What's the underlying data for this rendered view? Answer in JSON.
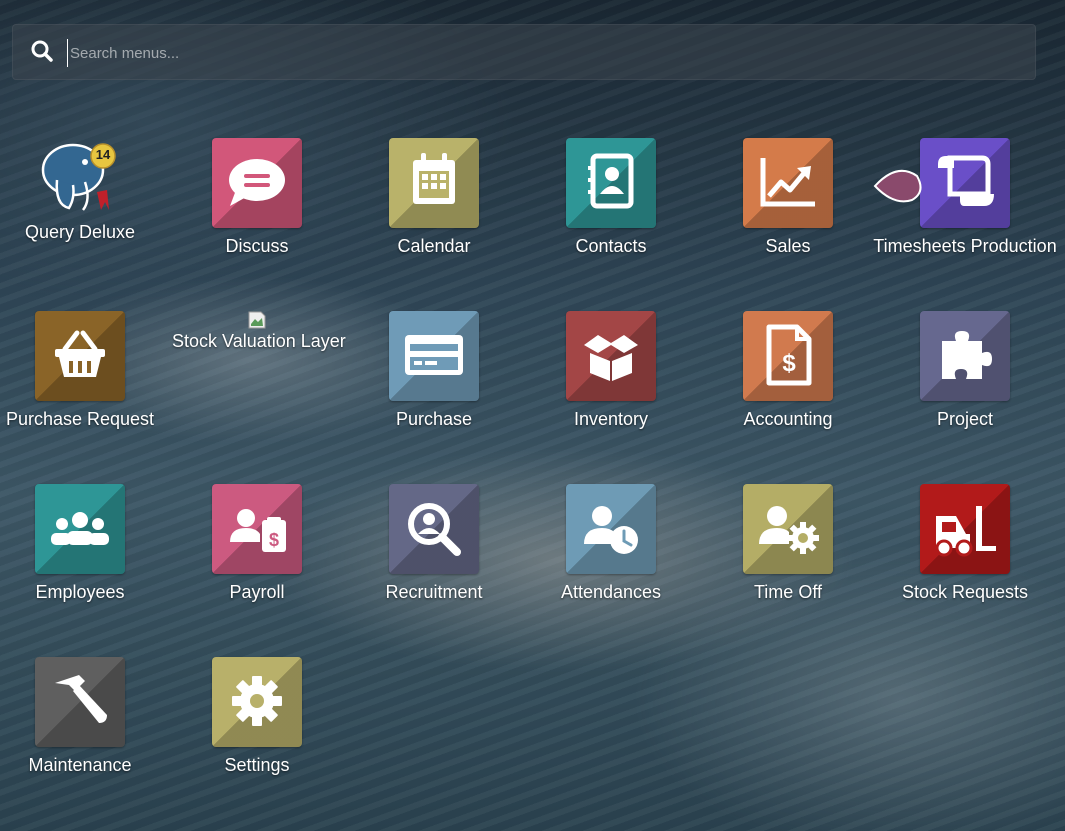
{
  "search": {
    "placeholder": "Search menus..."
  },
  "apps": {
    "query_deluxe": {
      "label": "Query Deluxe",
      "badge": "14",
      "icon": "postgresql-elephant-icon"
    },
    "discuss": {
      "label": "Discuss",
      "color": "#d2577a",
      "icon": "chat-bubble-icon"
    },
    "calendar": {
      "label": "Calendar",
      "color": "#b9b26a",
      "icon": "calendar-icon"
    },
    "contacts": {
      "label": "Contacts",
      "color": "#2e9696",
      "icon": "address-book-icon"
    },
    "sales": {
      "label": "Sales",
      "color": "#d47b4a",
      "icon": "line-chart-icon"
    },
    "timesheets_production": {
      "label": "Timesheets Production",
      "color": "#6a4fc8",
      "icon": "scroll-icon"
    },
    "purchase_request": {
      "label": "Purchase Request",
      "color": "#8a6428",
      "icon": "basket-icon"
    },
    "stock_valuation_layer": {
      "label": "Stock Valuation Layer",
      "icon": "broken-image-icon"
    },
    "purchase": {
      "label": "Purchase",
      "color": "#6f9bb7",
      "icon": "credit-card-icon"
    },
    "inventory": {
      "label": "Inventory",
      "color": "#a34646",
      "icon": "open-box-icon"
    },
    "accounting": {
      "label": "Accounting",
      "color": "#d17a4e",
      "icon": "invoice-dollar-icon"
    },
    "project": {
      "label": "Project",
      "color": "#66688f",
      "icon": "puzzle-piece-icon"
    },
    "employees": {
      "label": "Employees",
      "color": "#2e9696",
      "icon": "group-users-icon"
    },
    "payroll": {
      "label": "Payroll",
      "color": "#cc5a80",
      "icon": "user-payslip-icon"
    },
    "recruitment": {
      "label": "Recruitment",
      "color": "#646887",
      "icon": "magnifier-user-icon"
    },
    "attendances": {
      "label": "Attendances",
      "color": "#6e9bb5",
      "icon": "user-clock-icon"
    },
    "time_off": {
      "label": "Time Off",
      "color": "#b4ad66",
      "icon": "user-gear-icon"
    },
    "stock_requests": {
      "label": "Stock Requests",
      "color": "#b21a1a",
      "icon": "forklift-icon"
    },
    "maintenance": {
      "label": "Maintenance",
      "color": "#5f5f5f",
      "icon": "hammer-icon"
    },
    "settings": {
      "label": "Settings",
      "color": "#b8b06a",
      "icon": "gear-icon"
    }
  }
}
